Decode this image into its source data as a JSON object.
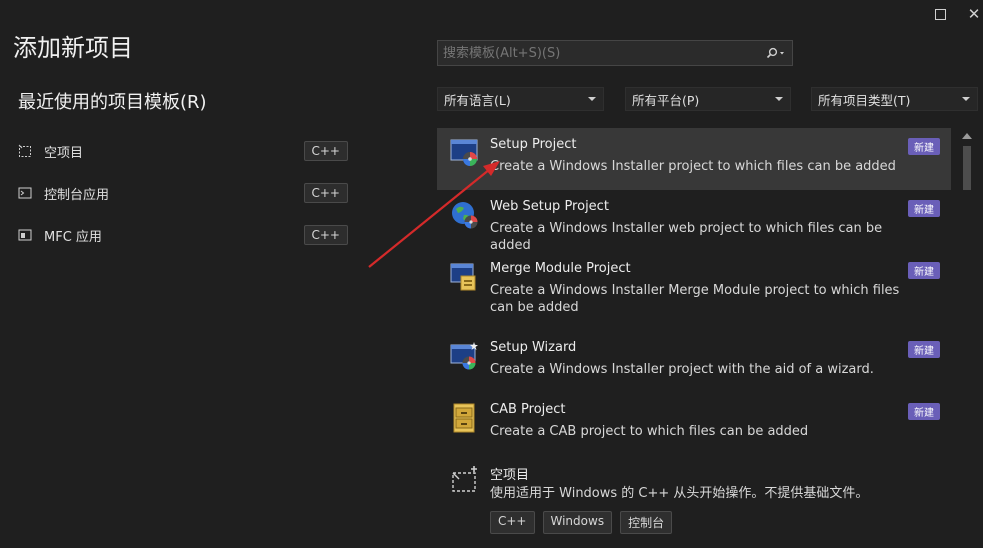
{
  "window": {
    "maximize_icon": "maximize-icon",
    "close_icon": "close-icon",
    "close_glyph": "✕"
  },
  "page_title": "添加新项目",
  "recent": {
    "title": "最近使用的项目模板(R)",
    "items": [
      {
        "label": "空项目",
        "tag": "C++",
        "icon": "empty-project-icon"
      },
      {
        "label": "控制台应用",
        "tag": "C++",
        "icon": "console-app-icon"
      },
      {
        "label": "MFC 应用",
        "tag": "C++",
        "icon": "mfc-app-icon"
      }
    ]
  },
  "search": {
    "placeholder": "搜索模板(Alt+S)(S)",
    "icon": "search-icon"
  },
  "filters": {
    "language": "所有语言(L)",
    "platform": "所有平台(P)",
    "project_type": "所有项目类型(T)"
  },
  "templates": [
    {
      "name": "Setup Project",
      "desc": "Create a Windows Installer project to which files can be added",
      "badge": "新建",
      "icon": "setup-project-icon",
      "selected": true
    },
    {
      "name": "Web Setup Project",
      "desc": "Create a Windows Installer web project to which files can be added",
      "badge": "新建",
      "icon": "web-setup-project-icon"
    },
    {
      "name": "Merge Module Project",
      "desc": "Create a Windows Installer Merge Module project to which files can be added",
      "badge": "新建",
      "icon": "merge-module-project-icon"
    },
    {
      "name": "Setup Wizard",
      "desc": "Create a Windows Installer project with the aid of a wizard.",
      "badge": "新建",
      "icon": "setup-wizard-icon"
    },
    {
      "name": "CAB Project",
      "desc": "Create a CAB project to which files can be added",
      "badge": "新建",
      "icon": "cab-project-icon"
    },
    {
      "name": "空项目",
      "desc": "使用适用于 Windows 的 C++ 从头开始操作。不提供基础文件。",
      "tags": [
        "C++",
        "Windows",
        "控制台"
      ],
      "icon": "empty-project-icon"
    }
  ],
  "colors": {
    "background": "#1f1f1f",
    "badge": "#6a5fb8",
    "selected_row": "#383838",
    "annotation_arrow": "#d42a2a"
  }
}
